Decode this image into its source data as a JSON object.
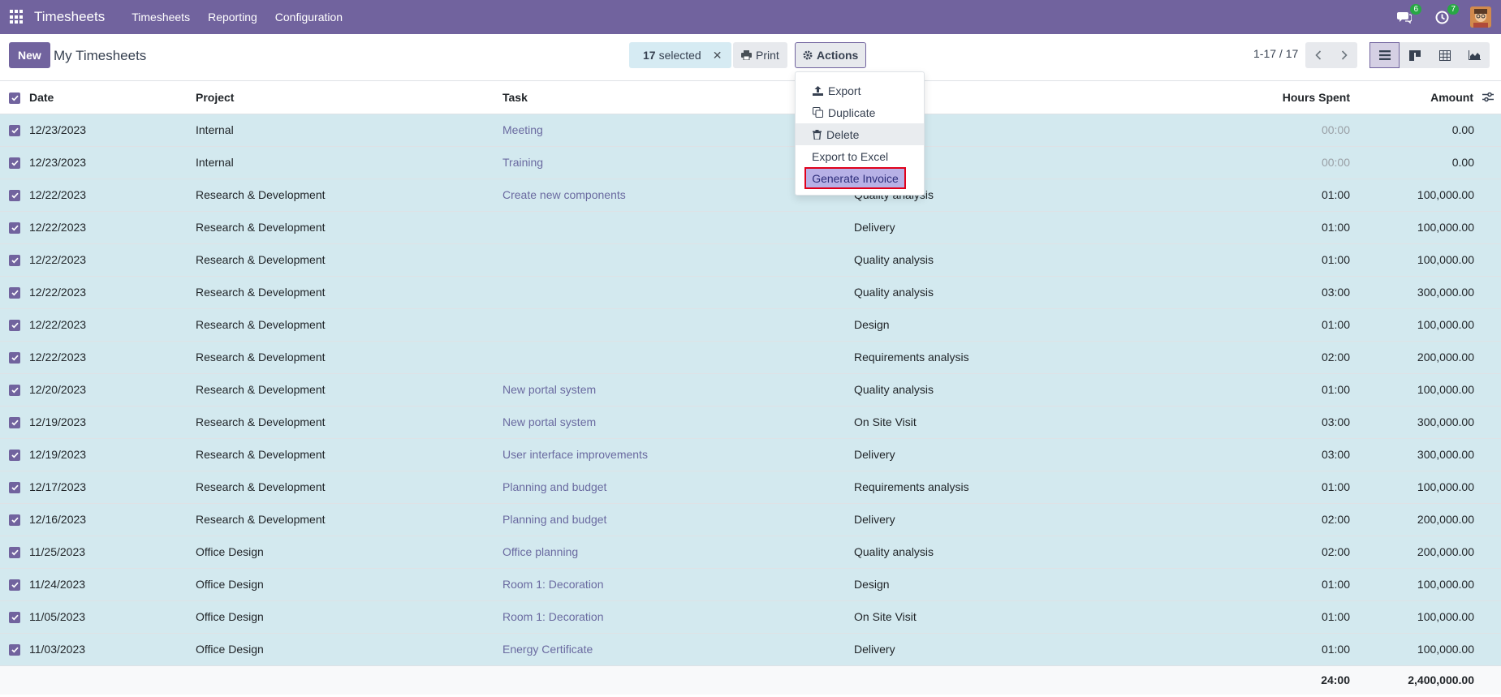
{
  "navbar": {
    "brand": "Timesheets",
    "menu": [
      "Timesheets",
      "Reporting",
      "Configuration"
    ],
    "messages_count": "6",
    "activities_count": "7"
  },
  "control": {
    "new_label": "New",
    "title": "My Timesheets",
    "selected_count": "17",
    "selected_label": "selected",
    "print_label": "Print",
    "actions_label": "Actions",
    "pager": "1-17 / 17"
  },
  "dropdown": {
    "export": "Export",
    "duplicate": "Duplicate",
    "delete": "Delete",
    "export_excel": "Export to Excel",
    "generate_invoice": "Generate Invoice"
  },
  "table": {
    "headers": {
      "date": "Date",
      "project": "Project",
      "task": "Task",
      "hours": "Hours Spent",
      "amount": "Amount"
    },
    "rows": [
      {
        "date": "12/23/2023",
        "project": "Internal",
        "task": "Meeting",
        "description": "",
        "hours": "00:00",
        "amount": "0.00"
      },
      {
        "date": "12/23/2023",
        "project": "Internal",
        "task": "Training",
        "description": "",
        "hours": "00:00",
        "amount": "0.00"
      },
      {
        "date": "12/22/2023",
        "project": "Research & Development",
        "task": "Create new components",
        "description": "Quality analysis",
        "hours": "01:00",
        "amount": "100,000.00"
      },
      {
        "date": "12/22/2023",
        "project": "Research & Development",
        "task": "",
        "description": "Delivery",
        "hours": "01:00",
        "amount": "100,000.00"
      },
      {
        "date": "12/22/2023",
        "project": "Research & Development",
        "task": "",
        "description": "Quality analysis",
        "hours": "01:00",
        "amount": "100,000.00"
      },
      {
        "date": "12/22/2023",
        "project": "Research & Development",
        "task": "",
        "description": "Quality analysis",
        "hours": "03:00",
        "amount": "300,000.00"
      },
      {
        "date": "12/22/2023",
        "project": "Research & Development",
        "task": "",
        "description": "Design",
        "hours": "01:00",
        "amount": "100,000.00"
      },
      {
        "date": "12/22/2023",
        "project": "Research & Development",
        "task": "",
        "description": "Requirements analysis",
        "hours": "02:00",
        "amount": "200,000.00"
      },
      {
        "date": "12/20/2023",
        "project": "Research & Development",
        "task": "New portal system",
        "description": "Quality analysis",
        "hours": "01:00",
        "amount": "100,000.00"
      },
      {
        "date": "12/19/2023",
        "project": "Research & Development",
        "task": "New portal system",
        "description": "On Site Visit",
        "hours": "03:00",
        "amount": "300,000.00"
      },
      {
        "date": "12/19/2023",
        "project": "Research & Development",
        "task": "User interface improvements",
        "description": "Delivery",
        "hours": "03:00",
        "amount": "300,000.00"
      },
      {
        "date": "12/17/2023",
        "project": "Research & Development",
        "task": "Planning and budget",
        "description": "Requirements analysis",
        "hours": "01:00",
        "amount": "100,000.00"
      },
      {
        "date": "12/16/2023",
        "project": "Research & Development",
        "task": "Planning and budget",
        "description": "Delivery",
        "hours": "02:00",
        "amount": "200,000.00"
      },
      {
        "date": "11/25/2023",
        "project": "Office Design",
        "task": "Office planning",
        "description": "Quality analysis",
        "hours": "02:00",
        "amount": "200,000.00"
      },
      {
        "date": "11/24/2023",
        "project": "Office Design",
        "task": "Room 1: Decoration",
        "description": "Design",
        "hours": "01:00",
        "amount": "100,000.00"
      },
      {
        "date": "11/05/2023",
        "project": "Office Design",
        "task": "Room 1: Decoration",
        "description": "On Site Visit",
        "hours": "01:00",
        "amount": "100,000.00"
      },
      {
        "date": "11/03/2023",
        "project": "Office Design",
        "task": "Energy Certificate",
        "description": "Delivery",
        "hours": "01:00",
        "amount": "100,000.00"
      }
    ],
    "totals": {
      "hours": "24:00",
      "amount": "2,400,000.00"
    }
  }
}
